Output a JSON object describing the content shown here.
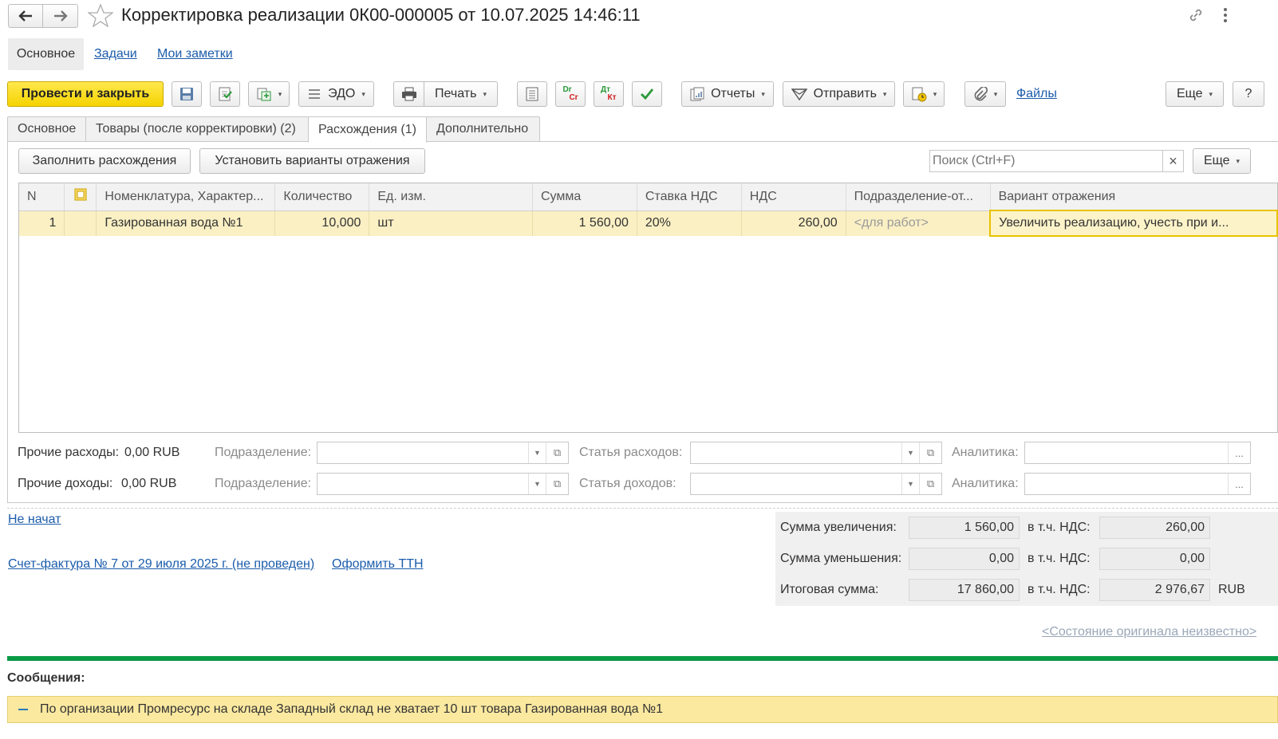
{
  "window": {
    "title": "Корректировка реализации 0К00-000005 от 10.07.2025 14:46:11"
  },
  "nav_tabs": {
    "main": "Основное",
    "tasks": "Задачи",
    "notes": "Мои заметки"
  },
  "toolbar": {
    "post_close": "Провести и закрыть",
    "edo": "ЭДО",
    "print": "Печать",
    "dr_cr_top": "Dr",
    "dr_cr_bottom": "Cr",
    "dt_kt_top": "Дт",
    "dt_kt_bottom": "Кт",
    "reports": "Отчеты",
    "send": "Отправить",
    "files": "Файлы",
    "more": "Еще",
    "help": "?"
  },
  "tabs": [
    "Основное",
    "Товары (после корректировки) (2)",
    "Расхождения (1)",
    "Дополнительно"
  ],
  "subtoolbar": {
    "fill": "Заполнить расхождения",
    "set_variants": "Установить варианты отражения",
    "search_placeholder": "Поиск (Ctrl+F)",
    "clear": "×",
    "more": "Еще"
  },
  "table": {
    "headers": [
      "N",
      "",
      "Номенклатура, Характер...",
      "Количество",
      "Ед. изм.",
      "Сумма",
      "Ставка НДС",
      "НДС",
      "Подразделение-от...",
      "Вариант отражения"
    ],
    "rows": [
      [
        "1",
        "",
        "Газированная вода №1",
        "10,000",
        "шт",
        "1 560,00",
        "20%",
        "260,00",
        "<для работ>",
        "Увеличить реализацию, учесть при и..."
      ]
    ]
  },
  "other": {
    "expenses_label": "Прочие расходы:",
    "expenses_value": "0,00 RUB",
    "income_label": "Прочие доходы:",
    "income_value": "0,00 RUB",
    "division_label": "Подразделение:",
    "expense_item_label": "Статья расходов:",
    "income_item_label": "Статья доходов:",
    "analytics_label": "Аналитика:",
    "ellipsis": "..."
  },
  "footer": {
    "status_link": "Не начат",
    "invoice_link": "Счет-фактура № 7 от 29 июля 2025 г. (не проведен)",
    "ttn_link": "Оформить ТТН",
    "original_state": "<Состояние оригинала неизвестно>"
  },
  "totals": {
    "increase_label": "Сумма увеличения:",
    "increase_value": "1 560,00",
    "decrease_label": "Сумма уменьшения:",
    "decrease_value": "0,00",
    "total_label": "Итоговая сумма:",
    "total_value": "17 860,00",
    "vat_label": "в т.ч. НДС:",
    "increase_vat": "260,00",
    "decrease_vat": "0,00",
    "total_vat": "2 976,67",
    "currency": "RUB"
  },
  "messages": {
    "title": "Сообщения:",
    "items": [
      "По организации Промресурс на складе Западный склад не хватает 10 шт товара Газированная вода №1"
    ]
  },
  "colors": {
    "accent_yellow": "#f5d300",
    "row_highlight": "#fbf0c4",
    "link": "#1b5cab",
    "divider_green": "#0a9a45"
  }
}
